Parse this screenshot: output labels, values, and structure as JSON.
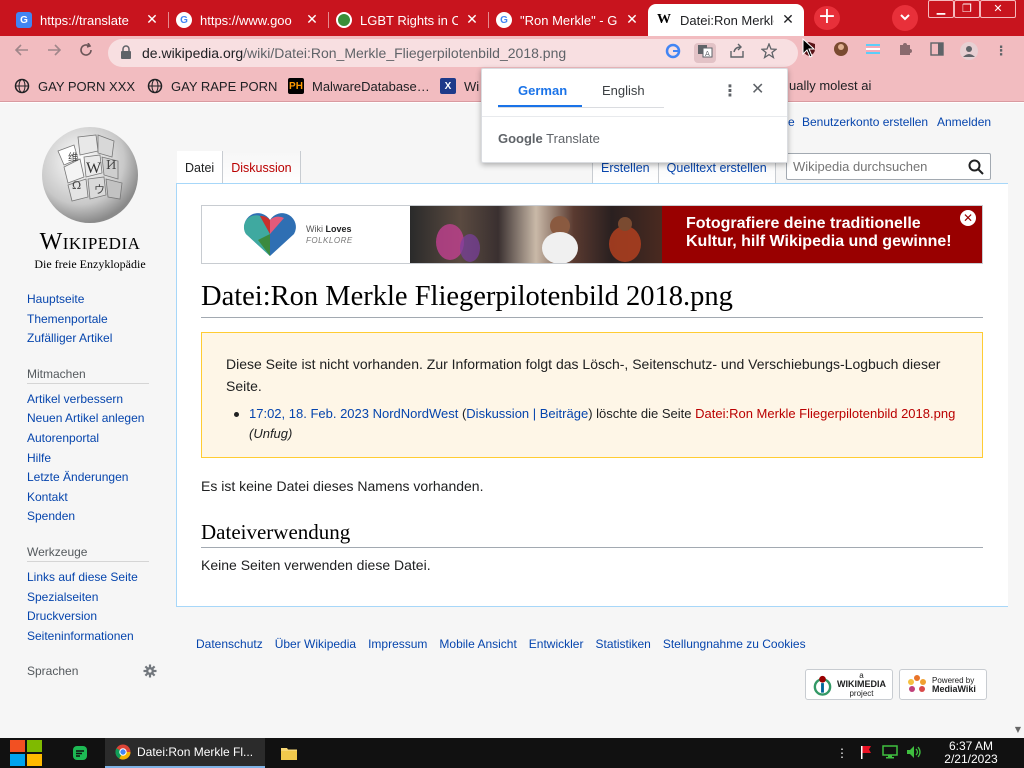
{
  "browser": {
    "tabs": [
      {
        "title": "https://translate",
        "favicon": "google-translate-icon"
      },
      {
        "title": "https://www.goo",
        "favicon": "google-g-icon"
      },
      {
        "title": "LGBT Rights in C",
        "favicon": "green-circle-icon"
      },
      {
        "title": "\"Ron Merkle\" - G",
        "favicon": "google-g-icon"
      },
      {
        "title": "Datei:Ron Merkle",
        "favicon": "wikipedia-w-icon",
        "active": true
      }
    ],
    "new_tab": "+",
    "url_host": "de.wikipedia.org",
    "url_path": "/wiki/Datei:Ron_Merkle_Fliegerpilotenbild_2018.png",
    "bookmarks": [
      "GAY PORN XXX",
      "GAY RAPE PORN",
      "MalwareDatabase…",
      "Wi",
      "ually molest ai"
    ],
    "colors": {
      "accent": "#c8141e",
      "toolbar": "#f2bcc0"
    }
  },
  "translate_popup": {
    "source_lang": "German",
    "target_lang": "English",
    "brand_google": "Google",
    "brand_translate": "Translate",
    "close": "✕",
    "menu": "⋮"
  },
  "wiki": {
    "wordmark": "Wikipedia",
    "tagline": "Die freie Enzyklopädie",
    "top_links": [
      "e",
      "Benutzerkonto erstellen",
      "Anmelden"
    ],
    "nav_main": [
      "Hauptseite",
      "Themenportale",
      "Zufälliger Artikel"
    ],
    "portal_mitmachen": {
      "heading": "Mitmachen",
      "items": [
        "Artikel verbessern",
        "Neuen Artikel anlegen",
        "Autorenportal",
        "Hilfe",
        "Letzte Änderungen",
        "Kontakt",
        "Spenden"
      ]
    },
    "portal_werkzeuge": {
      "heading": "Werkzeuge",
      "items": [
        "Links auf diese Seite",
        "Spezialseiten",
        "Druckversion",
        "Seiteninformationen"
      ]
    },
    "portal_sprachen": {
      "heading": "Sprachen"
    },
    "tabs_left": [
      "Datei",
      "Diskussion"
    ],
    "tabs_right": [
      "Erstellen",
      "Quelltext erstellen"
    ],
    "search_placeholder": "Wikipedia durchsuchen",
    "banner": {
      "wlf_line1": "Wiki",
      "wlf_line1b": "Loves",
      "wlf_line2": "FOLKLORE",
      "text": "Fotografiere deine traditionelle Kultur, hilf Wikipedia und gewinne!",
      "close": "✕"
    },
    "title": "Datei:Ron Merkle Fliegerpilotenbild 2018.png",
    "notice": {
      "text": "Diese Seite ist nicht vorhanden. Zur Information folgt das Lösch-, Seitenschutz- und Verschiebungs-Logbuch dieser Seite.",
      "log_time": "17:02, 18. Feb. 2023",
      "log_user": "NordNordWest",
      "log_open": " (",
      "log_talk": "Diskussion",
      "log_pipe": " | ",
      "log_contribs": "Beiträge",
      "log_action": ") löschte die Seite ",
      "log_page": "Datei:Ron Merkle Fliegerpilotenbild 2018.png",
      "log_reason": "(Unfug)"
    },
    "no_file": "Es ist keine Datei dieses Namens vorhanden.",
    "section_heading": "Dateiverwendung",
    "section_text": "Keine Seiten verwenden diese Datei.",
    "footer_links": [
      "Datenschutz",
      "Über Wikipedia",
      "Impressum",
      "Mobile Ansicht",
      "Entwickler",
      "Statistiken",
      "Stellungnahme zu Cookies"
    ],
    "badge_wikimedia": {
      "line1": "a",
      "line2": "WIKIMEDIA",
      "line3": "project"
    },
    "badge_mediawiki": {
      "line1": "Powered by",
      "line2": "MediaWiki"
    }
  },
  "taskbar": {
    "chrome_title": "Datei:Ron Merkle Fl...",
    "time": "6:37 AM",
    "date": "2/21/2023"
  }
}
